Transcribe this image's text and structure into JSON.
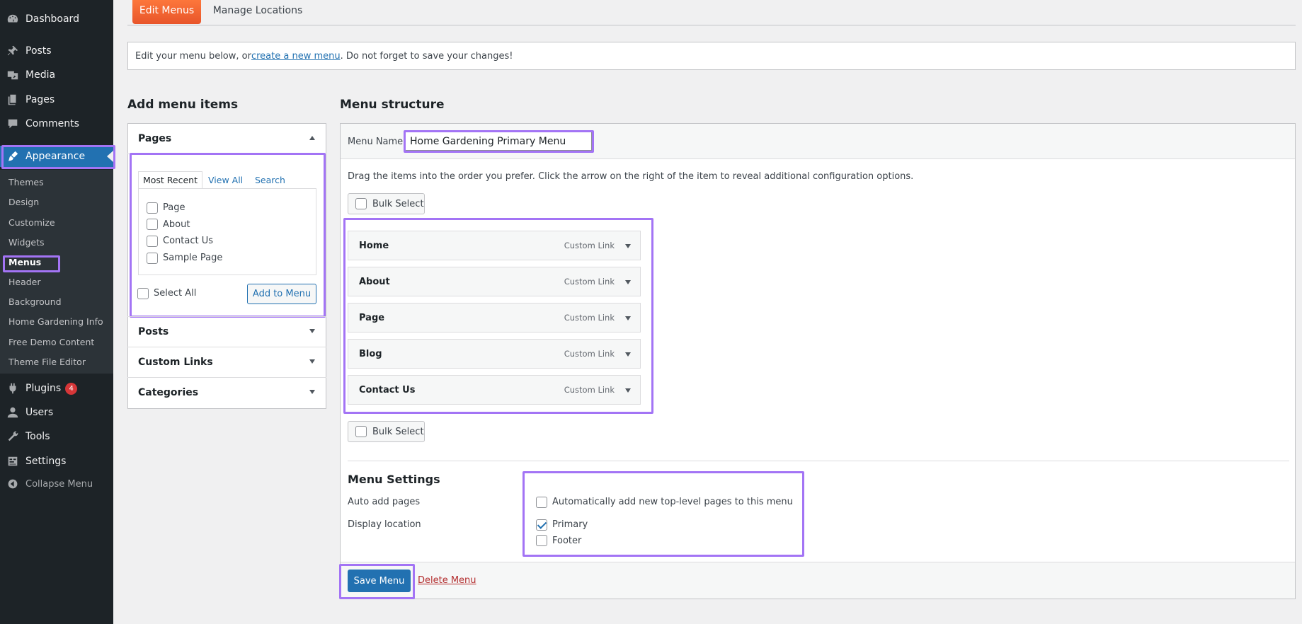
{
  "sidebar": {
    "items": [
      {
        "label": "Dashboard",
        "icon": "dashboard-icon"
      },
      {
        "label": "Posts",
        "icon": "pin-icon"
      },
      {
        "label": "Media",
        "icon": "media-icon"
      },
      {
        "label": "Pages",
        "icon": "pages-icon"
      },
      {
        "label": "Comments",
        "icon": "comment-icon"
      },
      {
        "label": "Appearance",
        "icon": "paintbrush-icon"
      }
    ],
    "submenu": [
      "Themes",
      "Design",
      "Customize",
      "Widgets",
      "Menus",
      "Header",
      "Background",
      "Home Gardening Info",
      "Free Demo Content",
      "Theme File Editor"
    ],
    "lower_items": [
      {
        "label": "Plugins",
        "icon": "plugin-icon",
        "badge": "4"
      },
      {
        "label": "Users",
        "icon": "users-icon"
      },
      {
        "label": "Tools",
        "icon": "wrench-icon"
      },
      {
        "label": "Settings",
        "icon": "settings-icon"
      }
    ],
    "collapse_label": "Collapse Menu"
  },
  "tabs": {
    "edit_menus": "Edit Menus",
    "manage_locations": "Manage Locations"
  },
  "notice": {
    "before": "Edit your menu below, or ",
    "link": "create a new menu",
    "after": ". Do not forget to save your changes!"
  },
  "add_items": {
    "title": "Add menu items",
    "pages_section": "Pages",
    "subtabs": [
      "Most Recent",
      "View All",
      "Search"
    ],
    "pages": [
      "Page",
      "About",
      "Contact Us",
      "Sample Page"
    ],
    "select_all": "Select All",
    "add_button": "Add to Menu",
    "other_sections": [
      "Posts",
      "Custom Links",
      "Categories"
    ]
  },
  "structure": {
    "title": "Menu structure",
    "menu_name_label": "Menu Name",
    "menu_name_value": "Home Gardening Primary Menu",
    "instructions": "Drag the items into the order you prefer. Click the arrow on the right of the item to reveal additional configuration options.",
    "bulk_select": "Bulk Select",
    "items": [
      {
        "title": "Home",
        "type": "Custom Link"
      },
      {
        "title": "About",
        "type": "Custom Link"
      },
      {
        "title": "Page",
        "type": "Custom Link"
      },
      {
        "title": "Blog",
        "type": "Custom Link"
      },
      {
        "title": "Contact Us",
        "type": "Custom Link"
      }
    ]
  },
  "settings": {
    "title": "Menu Settings",
    "auto_add_label": "Auto add pages",
    "auto_add_option": "Automatically add new top-level pages to this menu",
    "display_location_label": "Display location",
    "locations": [
      {
        "label": "Primary",
        "checked": true
      },
      {
        "label": "Footer",
        "checked": false
      }
    ]
  },
  "footer": {
    "save": "Save Menu",
    "delete": "Delete Menu"
  },
  "colors": {
    "accent": "#2271b1",
    "highlight": "#a374f5",
    "tab_active": "#e8552a",
    "sidebar": "#1d2327"
  }
}
